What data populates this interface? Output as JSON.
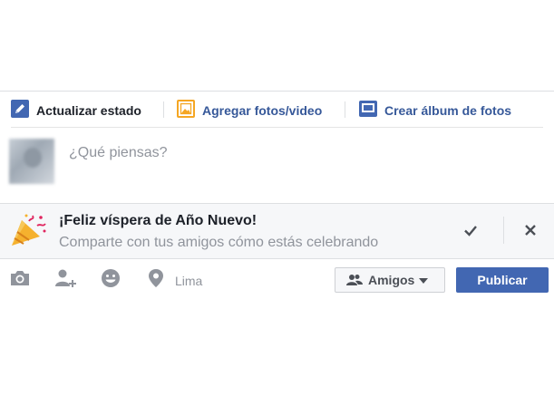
{
  "tabs": {
    "status_label": "Actualizar estado",
    "photos_label": "Agregar fotos/video",
    "album_label": "Crear álbum de fotos"
  },
  "composer": {
    "placeholder": "¿Qué piensas?"
  },
  "banner": {
    "title": "¡Feliz víspera de Año Nuevo!",
    "subtitle": "Comparte con tus amigos cómo estás celebrando"
  },
  "actions": {
    "location_label": "Lima",
    "audience_label": "Amigos",
    "publish_label": "Publicar"
  },
  "icons": {
    "status": "pencil-icon",
    "photos": "photo-icon",
    "album": "album-icon",
    "banner": "party-popper-icon",
    "confirm": "check-icon",
    "dismiss": "close-icon",
    "camera": "camera-icon",
    "tag": "tag-friends-icon",
    "feeling": "smiley-icon",
    "location": "location-pin-icon",
    "audience": "friends-icon",
    "caret": "caret-down-icon"
  },
  "colors": {
    "link": "#365899",
    "primary": "#4267b2",
    "muted": "#90949c",
    "banner_bg": "#f6f7f9"
  }
}
